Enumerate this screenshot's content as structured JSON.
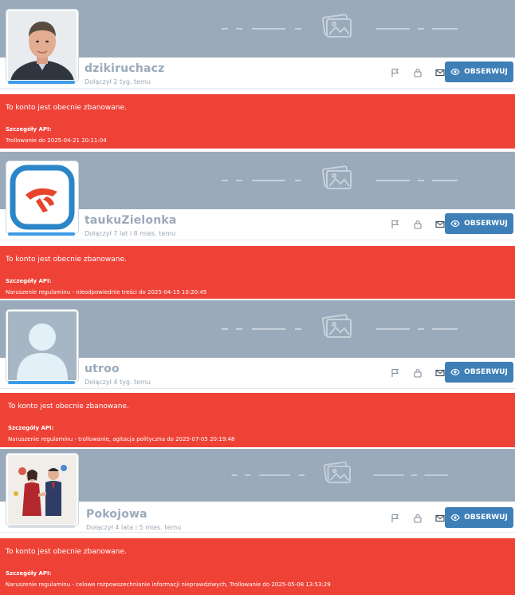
{
  "ban_message": "To konto jest obecnie zbanowane.",
  "api_label": "Szczegóły API:",
  "follow_label": "OBSERWUJ",
  "colors": {
    "banner": "#9aaaba",
    "ban_bg": "#ee4237",
    "follow_btn": "#3e7fb8",
    "avatar_bar_active": "#3d9be9",
    "avatar_bar_inactive": "#d8dde2"
  },
  "icons": [
    "flag-icon",
    "lock-icon",
    "mail-icon",
    "eye-icon",
    "image-placeholder-icon"
  ],
  "profiles": [
    {
      "username": "dzikiruchacz",
      "joined": "Dołączył 2 tyg. temu",
      "ban_detail": "Trollowanie do 2025-04-21 20:11:04",
      "avatar": "portrait-photo"
    },
    {
      "username": "taukuZielonka",
      "joined": "Dołączył 7 lat i 8 mies. temu",
      "ban_detail": "Naruszenie regulaminu - nieodpowiednie treści do 2025-04-15 10:20:45",
      "avatar": "orlen-logo"
    },
    {
      "username": "utroo",
      "joined": "Dołączył 4 tyg. temu",
      "ban_detail": "Naruszenie regulaminu - trollowanie, agitacja polityczna do 2025-07-05 20:19:48",
      "avatar": "default-avatar"
    },
    {
      "username": "Pokojowa",
      "joined": "Dołączył 4 lata i 5 mies. temu",
      "ban_detail": "Naruszenie regulaminu - celowe rozpowszechnianie informacji nieprawdziwych, Trollowanie do 2025-05-08 13:53:29",
      "avatar": "cartoon-handshake"
    }
  ]
}
